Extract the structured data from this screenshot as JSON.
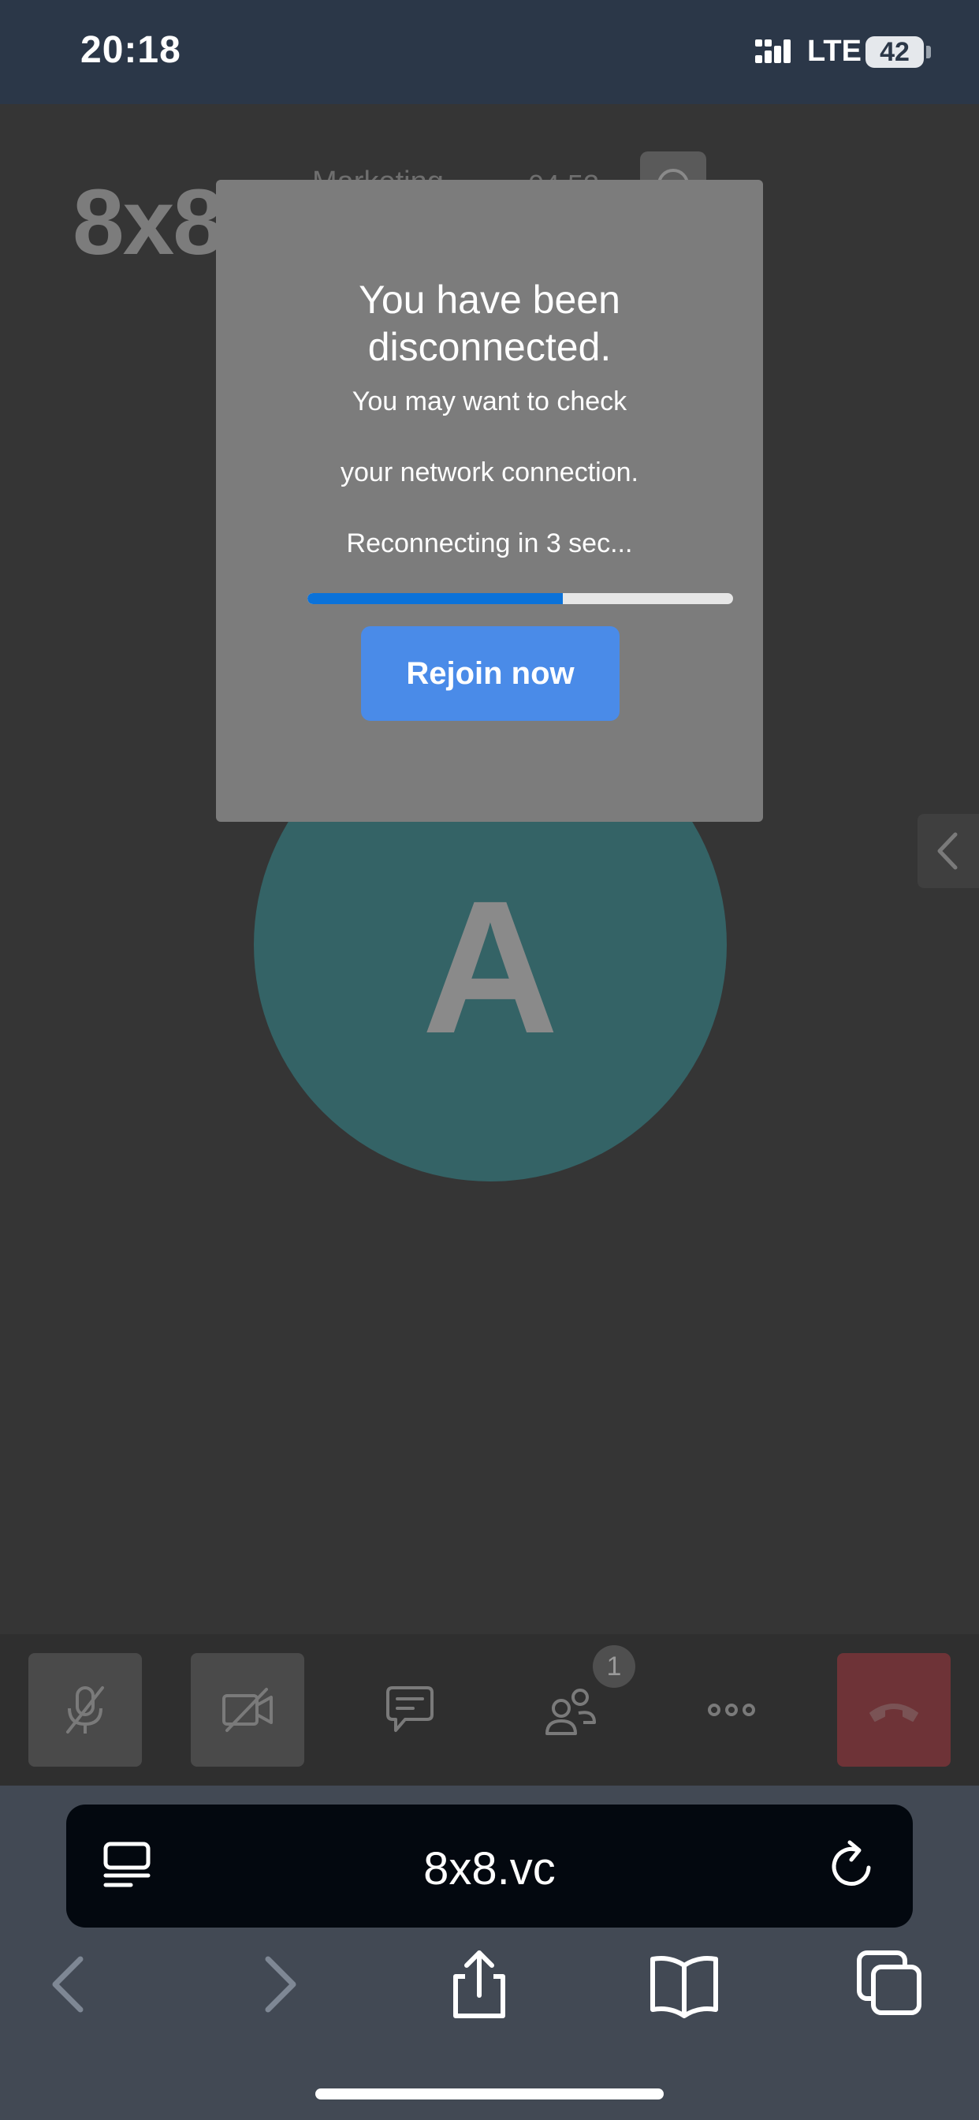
{
  "status_bar": {
    "time": "20:18",
    "network": "LTE",
    "battery": "42"
  },
  "meeting": {
    "logo": "8x8",
    "name": "Marketing",
    "timer": "04:53",
    "avatar_initial": "A",
    "avatar_color": "#346366"
  },
  "dialog": {
    "title": "You have been disconnected.",
    "line1": "You may want to check",
    "line2": "your network connection.",
    "countdown": "Reconnecting in 3 sec...",
    "progress": 0.6,
    "rejoin_label": "Rejoin now"
  },
  "toolbar": {
    "participants_count": "1",
    "hangup_color": "#6e3337",
    "icons": [
      "microphone-muted-icon",
      "camera-off-icon",
      "chat-icon",
      "participants-icon",
      "more-icon",
      "hangup-icon"
    ]
  },
  "browser": {
    "url": "8x8.vc",
    "icons": [
      "reader-icon",
      "reload-icon",
      "back-icon",
      "forward-icon",
      "share-icon",
      "bookmarks-icon",
      "tabs-icon"
    ]
  }
}
